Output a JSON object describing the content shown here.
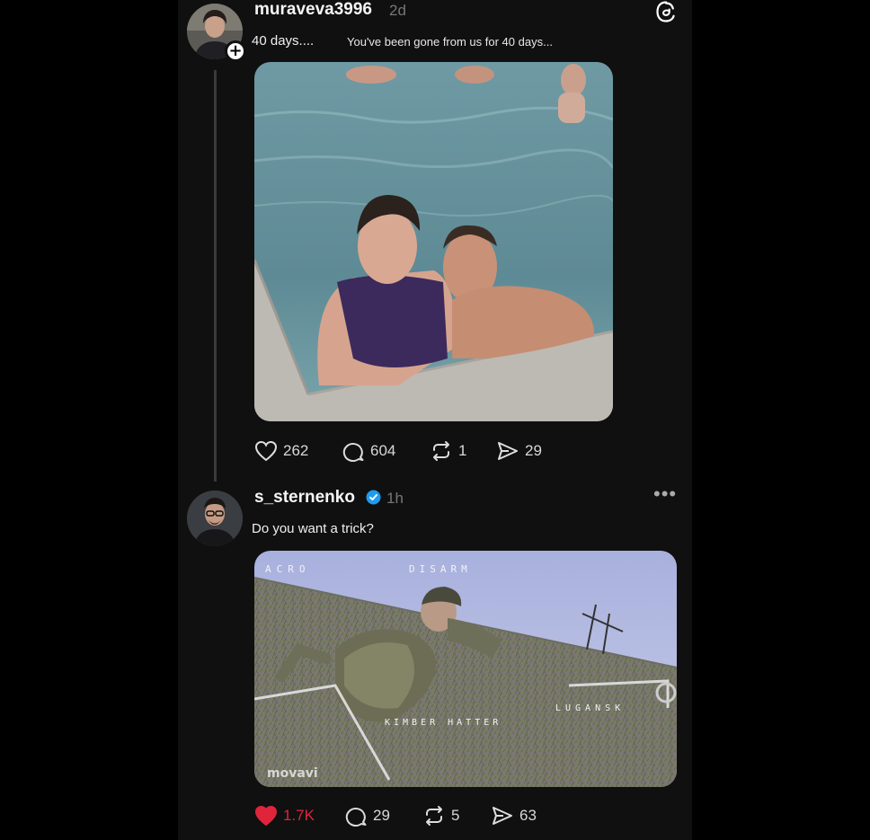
{
  "app": {
    "logo_icon": "threads-logo-icon"
  },
  "post1": {
    "username": "muraveva3996",
    "time": "2d",
    "text_primary": "40 days....",
    "text_secondary": "You've been gone from us for 40 days...",
    "image_desc_icon": "photo-couple-in-pool",
    "actions": {
      "likes": "262",
      "comments": "604",
      "reposts": "1",
      "shares": "29"
    }
  },
  "post2": {
    "username": "s_sternenko",
    "verified": true,
    "time": "1h",
    "text": "Do you want a trick?",
    "video_overlay": {
      "top_left": "ACRO",
      "top_center": "DISARM",
      "bottom_right": "LUGANSK",
      "bottom_center": "KIMBER HATTER",
      "watermark": "movavi"
    },
    "actions": {
      "likes": "1.7K",
      "comments": "29",
      "reposts": "5",
      "shares": "63"
    }
  },
  "colors": {
    "background": "#000000",
    "panel": "#101010",
    "like_active": "#e0243b",
    "verified_blue": "#1d9bf0"
  }
}
